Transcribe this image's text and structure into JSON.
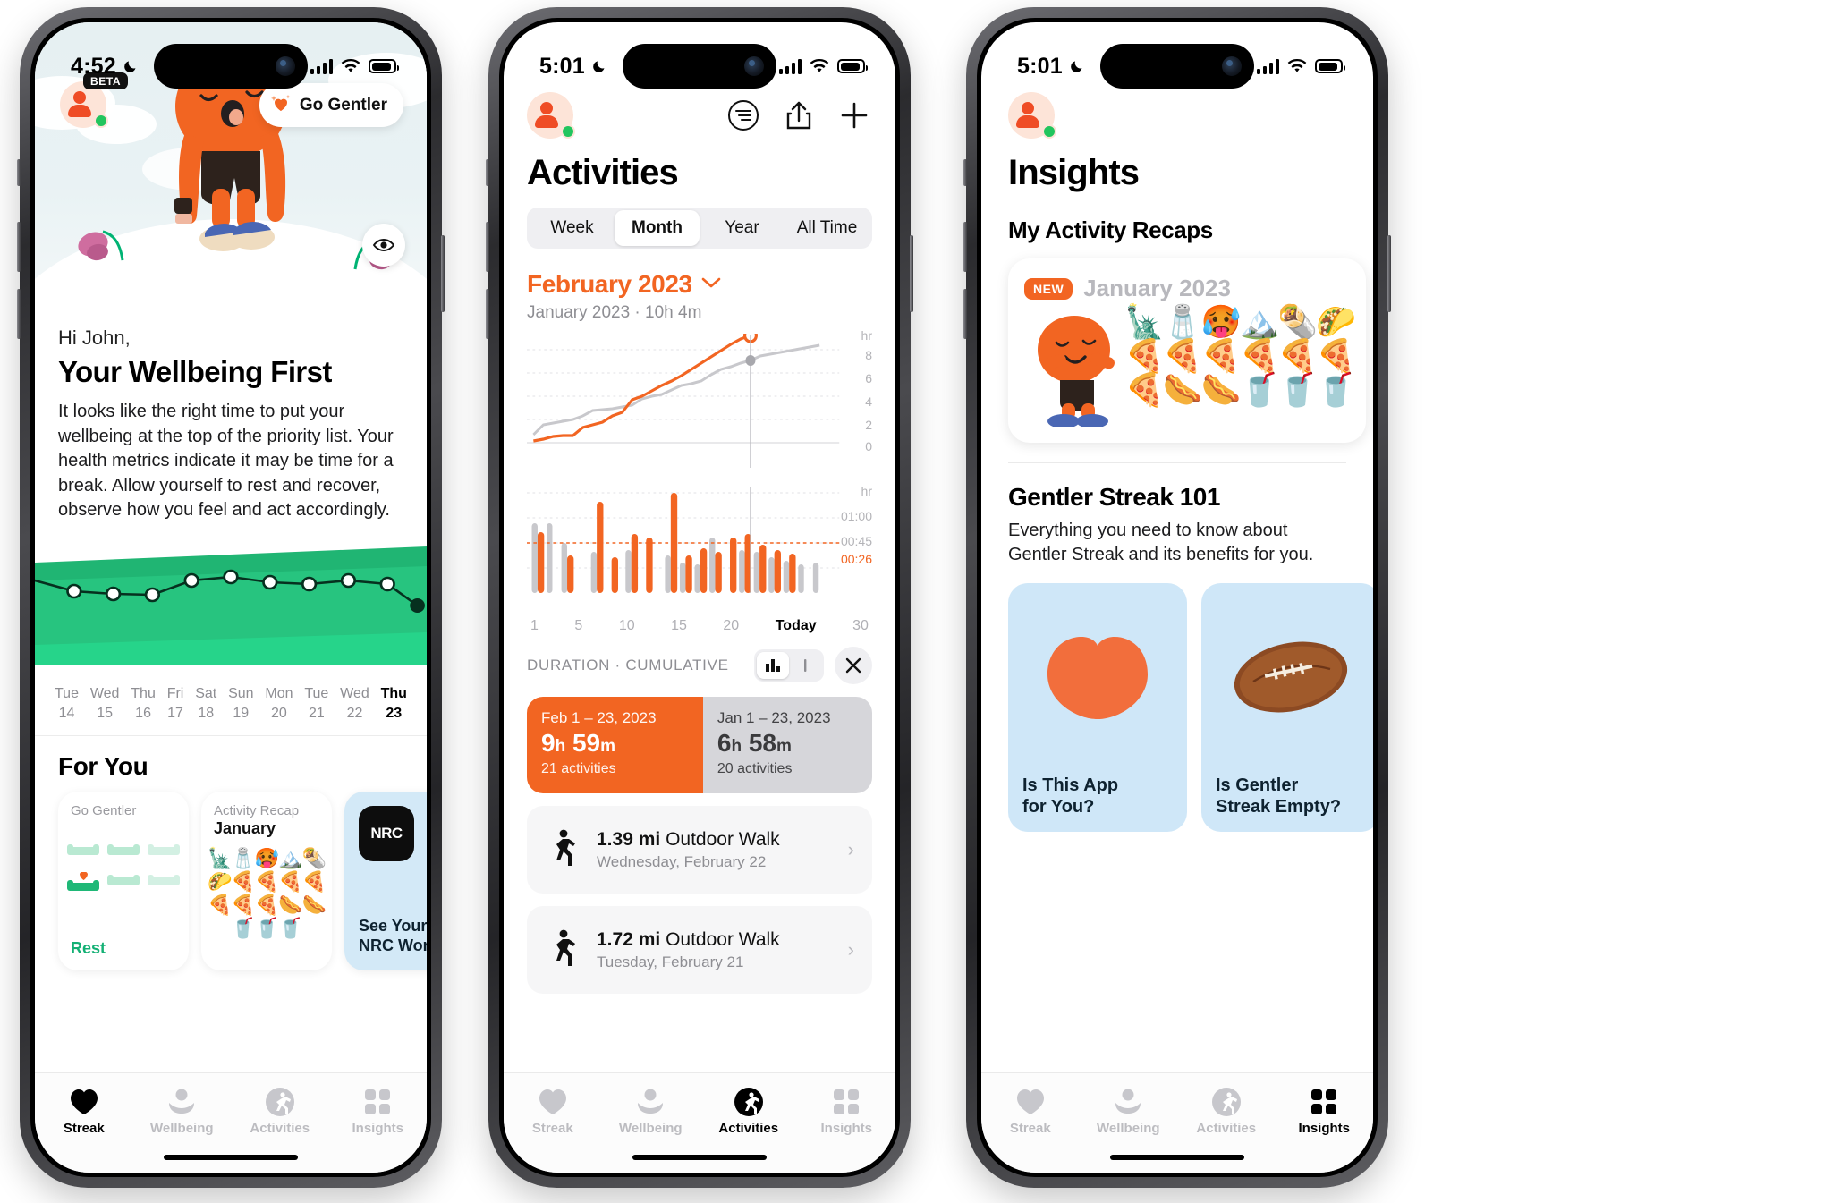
{
  "screen1": {
    "status": {
      "time": "4:52",
      "moon": "crescent-moon-icon"
    },
    "badge": "BETA",
    "go_gentler": "Go Gentler",
    "greeting": "Hi John,",
    "title": "Your Wellbeing First",
    "body": "It looks like the right time to put your wellbeing at the top of the priority list. Your health metrics indicate it may be time for a break. Allow yourself to rest and recover, observe how you feel and act accordingly.",
    "days": [
      {
        "dow": "Tue",
        "num": "14",
        "active": false
      },
      {
        "dow": "Wed",
        "num": "15",
        "active": false
      },
      {
        "dow": "Thu",
        "num": "16",
        "active": false
      },
      {
        "dow": "Fri",
        "num": "17",
        "active": false
      },
      {
        "dow": "Sat",
        "num": "18",
        "active": false
      },
      {
        "dow": "Sun",
        "num": "19",
        "active": false
      },
      {
        "dow": "Mon",
        "num": "20",
        "active": false
      },
      {
        "dow": "Tue",
        "num": "21",
        "active": false
      },
      {
        "dow": "Wed",
        "num": "22",
        "active": false
      },
      {
        "dow": "Thu",
        "num": "23",
        "active": true
      }
    ],
    "for_you_title": "For You",
    "cards": [
      {
        "kicker": "Go Gentler",
        "title": "",
        "footer": "Rest"
      },
      {
        "kicker": "Activity Recap",
        "title": "January",
        "emoji": "🗽🧂🥵🏔️🌯🌮🍕🍕🍕🍕🍕🍕🍕🌭🌭🥤🥤🥤"
      },
      {
        "title": "See Your\nNRC Workouts",
        "brand": "NRC"
      }
    ],
    "tabs": [
      {
        "label": "Streak",
        "icon": "heart-icon",
        "active": true
      },
      {
        "label": "Wellbeing",
        "icon": "person-lotus-icon",
        "active": false
      },
      {
        "label": "Activities",
        "icon": "runner-icon",
        "active": false
      },
      {
        "label": "Insights",
        "icon": "grid-icon",
        "active": false
      }
    ]
  },
  "screen2": {
    "status": {
      "time": "5:01"
    },
    "title": "Activities",
    "header_icons": [
      "filter-icon",
      "share-icon",
      "plus-icon"
    ],
    "segments": [
      {
        "label": "Week",
        "active": false
      },
      {
        "label": "Month",
        "active": true
      },
      {
        "label": "Year",
        "active": false
      },
      {
        "label": "All Time",
        "active": false
      }
    ],
    "month": "February 2023",
    "month_chevron": "chevron-down-icon",
    "subtitle": "January 2023 · 10h 4m",
    "duration_label": "DURATION · CUMULATIVE",
    "toggle": {
      "bar": "bar-chart-icon",
      "line": "line-icon",
      "close": "close-icon"
    },
    "comparison": [
      {
        "range": "Feb 1 – 23, 2023",
        "hours": "9",
        "h_unit": "h",
        "mins": "59",
        "m_unit": "m",
        "count": "21 activities",
        "color": "#f26522"
      },
      {
        "range": "Jan 1 – 23, 2023",
        "hours": "6",
        "h_unit": "h",
        "mins": "58",
        "m_unit": "m",
        "count": "20 activities",
        "color": "#d6d6da"
      }
    ],
    "activities": [
      {
        "distance": "1.39 mi",
        "type": "Outdoor Walk",
        "date": "Wednesday, February 22",
        "icon": "walk-icon"
      },
      {
        "distance": "1.72 mi",
        "type": "Outdoor Walk",
        "date": "Tuesday, February 21",
        "icon": "walk-icon"
      }
    ],
    "tabs": [
      {
        "label": "Streak",
        "icon": "heart-icon",
        "active": false
      },
      {
        "label": "Wellbeing",
        "icon": "person-lotus-icon",
        "active": false
      },
      {
        "label": "Activities",
        "icon": "runner-icon",
        "active": true
      },
      {
        "label": "Insights",
        "icon": "grid-icon",
        "active": false
      }
    ],
    "chart_data": {
      "type": "line",
      "title": "February 2023 cumulative duration",
      "xlabel": "",
      "ylabel": "hr",
      "legend": [
        "February 2023",
        "January 2023"
      ],
      "x": [
        1,
        2,
        3,
        4,
        5,
        6,
        7,
        8,
        9,
        10,
        11,
        12,
        13,
        14,
        15,
        16,
        17,
        18,
        19,
        20,
        21,
        22,
        23,
        24,
        25,
        26,
        27,
        28,
        29,
        30
      ],
      "y_ticks": [
        "8",
        "6",
        "4",
        "2",
        "0"
      ],
      "y_unit": "hr",
      "x_ticks": [
        "1",
        "5",
        "10",
        "15",
        "20",
        "Today",
        "30"
      ],
      "series": [
        {
          "name": "February 2023",
          "color": "#f26522",
          "values": [
            0.1,
            0.3,
            0.5,
            0.6,
            0.6,
            1.2,
            1.4,
            1.6,
            2.1,
            2.4,
            3.4,
            3.8,
            4.3,
            4.8,
            5.2,
            5.7,
            6.3,
            6.9,
            7.4,
            8.0,
            8.6,
            9.2,
            9.98,
            null,
            null,
            null,
            null,
            null,
            null,
            null
          ]
        },
        {
          "name": "January 2023",
          "color": "#c8c8cc",
          "values": [
            0.4,
            0.9,
            1.1,
            1.2,
            1.3,
            1.6,
            2.0,
            2.1,
            2.2,
            2.3,
            2.5,
            3.0,
            3.3,
            3.5,
            3.9,
            4.3,
            4.5,
            4.8,
            5.4,
            5.9,
            6.2,
            6.6,
            6.97,
            7.6,
            8.0,
            8.4,
            8.8,
            9.2,
            9.6,
            10.07
          ]
        }
      ],
      "marker_today_index": 23
    },
    "bar_chart_data": {
      "type": "bar",
      "ylabel": "hr",
      "y_ticks": [
        "01:00",
        "00:45",
        "00:26"
      ],
      "average_line": "00:26",
      "x_ticks": [
        "1",
        "5",
        "10",
        "15",
        "20",
        "Today",
        "30"
      ],
      "series": [
        {
          "name": "February 2023",
          "color": "#f26522",
          "values": [
            0.42,
            0.1,
            0.0,
            0.0,
            0.95,
            0.0,
            0.28,
            0.52,
            0.5,
            0.0,
            1.35,
            0.3,
            0.38,
            0.0,
            0.33,
            0.5,
            0.57,
            0.45,
            0.44,
            0.4,
            0.3,
            0.28,
            0.22,
            0,
            0,
            0,
            0,
            0,
            0,
            0
          ]
        },
        {
          "name": "January 2023",
          "color": "#c8c8cc",
          "values": [
            0.62,
            0.62,
            0.0,
            0.45,
            0.0,
            0.35,
            0.0,
            0.0,
            0.0,
            0.0,
            0.33,
            0.0,
            0.3,
            0.0,
            0.55,
            0.0,
            0.4,
            0.3,
            0.0,
            0.0,
            0.28,
            0.35,
            0.26,
            0,
            0.3,
            0.24,
            0.2,
            0,
            0,
            0
          ]
        }
      ]
    }
  },
  "screen3": {
    "status": {
      "time": "5:01"
    },
    "title": "Insights",
    "section1": "My Activity Recaps",
    "recap": {
      "badge": "NEW",
      "month": "January",
      "year": "2023",
      "emoji": "🗽🧂🥵🏔️🌯🌮🍕🍕🍕🍕🍕🍕🍕🌭🌭🥤🥤🥤"
    },
    "section2_title": "Gentler Streak 101",
    "section2_body": "Everything you need to know about Gentler Streak and its benefits for you.",
    "tiles": [
      {
        "label": "Is This App\nfor You?",
        "art": "blob-icon"
      },
      {
        "label": "Is Gentler\nStreak Empty?",
        "art": "football-icon"
      }
    ],
    "tabs": [
      {
        "label": "Streak",
        "icon": "heart-icon",
        "active": false
      },
      {
        "label": "Wellbeing",
        "icon": "person-lotus-icon",
        "active": false
      },
      {
        "label": "Activities",
        "icon": "runner-icon",
        "active": false
      },
      {
        "label": "Insights",
        "icon": "grid-icon",
        "active": true
      }
    ]
  },
  "colors": {
    "accent": "#f26522",
    "green": "#21c27a",
    "gray": "#c8c8cc",
    "dark": "#0e2230"
  }
}
